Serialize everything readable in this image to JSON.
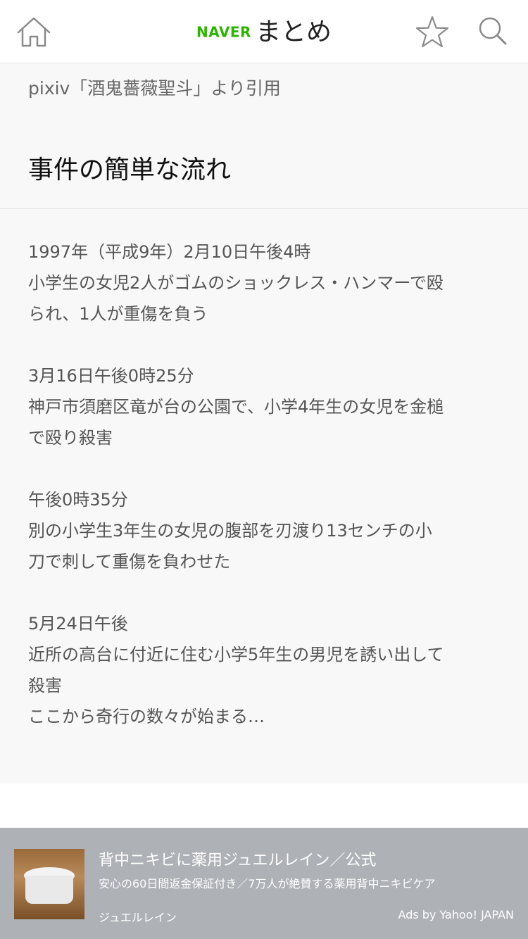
{
  "header": {
    "logo_brand": "NAVER",
    "logo_service": "まとめ",
    "icons": [
      "home-icon",
      "star-icon",
      "search-icon"
    ],
    "brand_color": "#2db400"
  },
  "content": {
    "citation": "pixiv「酒鬼薔薇聖斗」より引用",
    "heading": "事件の簡単な流れ",
    "events": [
      {
        "date": "1997年（平成9年）2月10日午後4時",
        "lines": [
          "小学生の女児2人がゴムのショックレス・ハンマーで殴",
          "られ、1人が重傷を負う"
        ]
      },
      {
        "date": "3月16日午後0時25分",
        "lines": [
          "神戸市須磨区竜が台の公園で、小学4年生の女児を金槌",
          "で殴り殺害"
        ]
      },
      {
        "date": "午後0時35分",
        "lines": [
          "別の小学生3年生の女児の腹部を刃渡り13センチの小",
          "刀で刺して重傷を負わせた"
        ]
      },
      {
        "date": "5月24日午後",
        "lines": [
          "近所の高台に付近に住む小学5年生の男児を誘い出して",
          "殺害",
          "ここから奇行の数々が始まる…"
        ]
      }
    ]
  },
  "ad": {
    "title": "背中ニキビに薬用ジュエルレイン／公式",
    "description": "安心の60日間返金保証付き／7万人が絶賛する薬用背中ニキビケア",
    "advertiser": "ジュエルレイン",
    "credit": "Ads by Yahoo! JAPAN"
  }
}
